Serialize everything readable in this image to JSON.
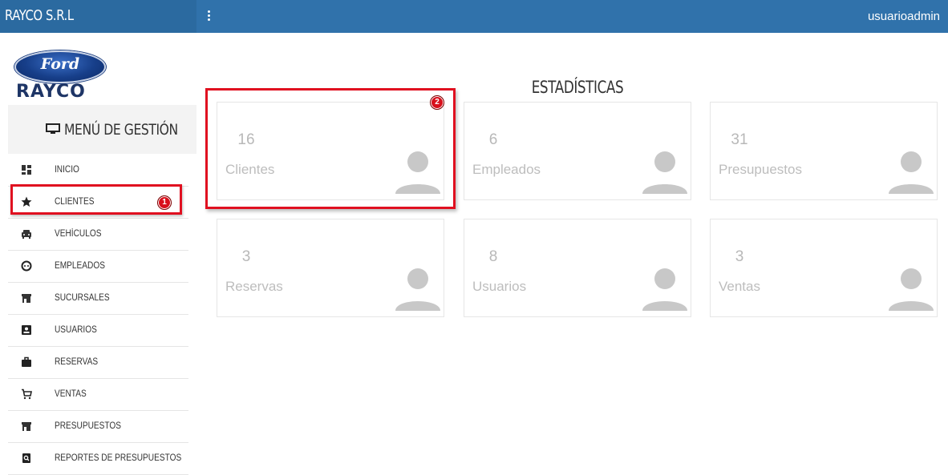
{
  "brand": {
    "name": "RAYCO S.R.L"
  },
  "topbar": {
    "user": "usuarioadmin"
  },
  "sidebar": {
    "logo_top": "Ford",
    "logo_bottom": "RAYCO",
    "menu_title": "MENÚ DE GESTIÓN",
    "items": [
      {
        "label": "INICIO",
        "icon": "dashboard-icon"
      },
      {
        "label": "CLIENTES",
        "icon": "star-icon"
      },
      {
        "label": "VEHÍCULOS",
        "icon": "car-icon"
      },
      {
        "label": "EMPLEADOS",
        "icon": "face-icon"
      },
      {
        "label": "SUCURSALES",
        "icon": "store-icon"
      },
      {
        "label": "USUARIOS",
        "icon": "contact-card-icon"
      },
      {
        "label": "RESERVAS",
        "icon": "briefcase-icon"
      },
      {
        "label": "VENTAS",
        "icon": "cart-icon"
      },
      {
        "label": "PRESUPUESTOS",
        "icon": "store-icon"
      },
      {
        "label": "REPORTES DE PRESUPUESTOS",
        "icon": "report-search-icon"
      }
    ]
  },
  "main": {
    "title": "ESTADÍSTICAS",
    "cards": [
      {
        "count": "16",
        "label": "Clientes"
      },
      {
        "count": "6",
        "label": "Empleados"
      },
      {
        "count": "31",
        "label": "Presupuestos"
      },
      {
        "count": "3",
        "label": "Reservas"
      },
      {
        "count": "8",
        "label": "Usuarios"
      },
      {
        "count": "3",
        "label": "Ventas"
      }
    ]
  },
  "annotations": {
    "badge1": "1",
    "badge2": "2"
  },
  "colors": {
    "topbar": "#3072ab",
    "brand_bar": "#2b6aa0",
    "highlight": "#e01020"
  }
}
